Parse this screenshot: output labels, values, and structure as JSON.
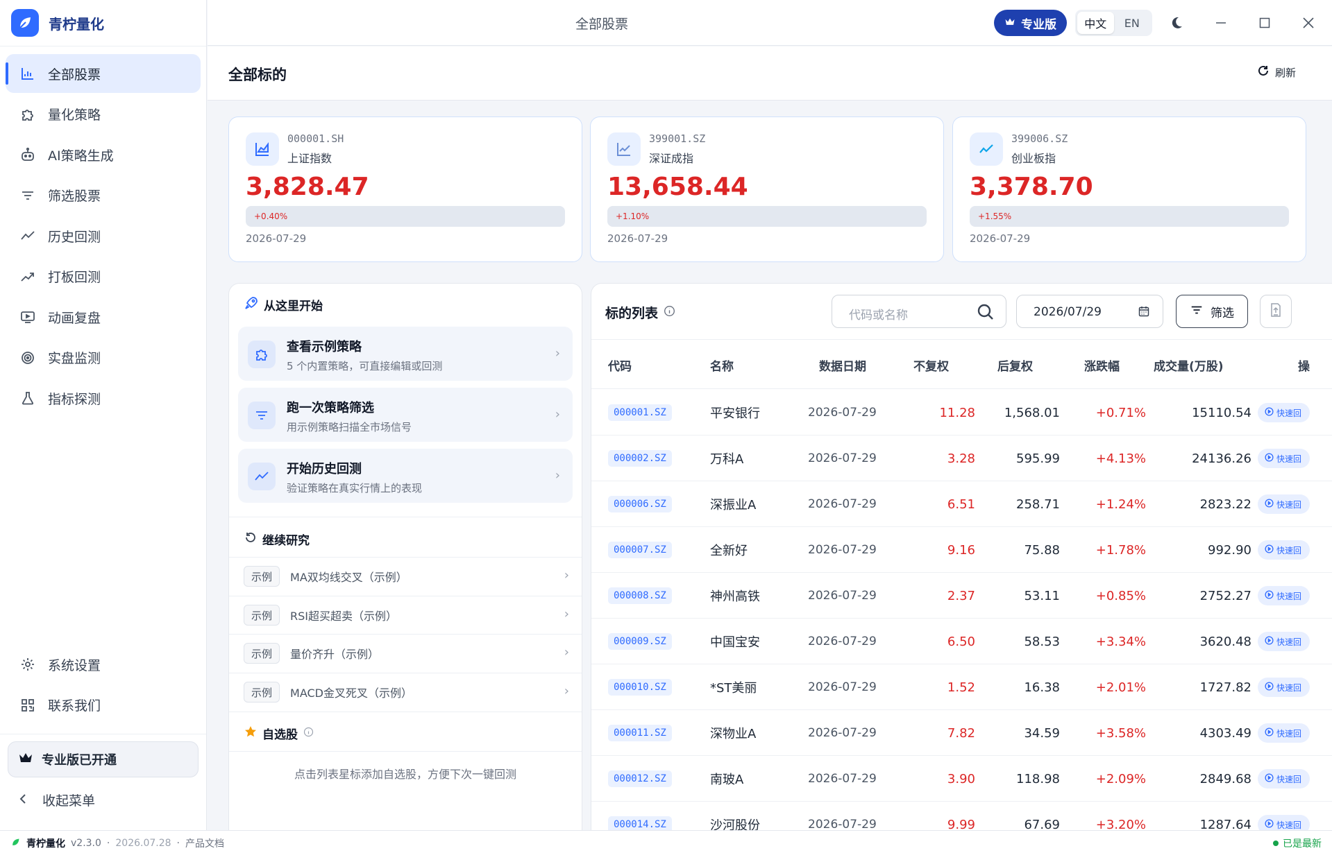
{
  "brand": {
    "name": "青柠量化"
  },
  "window": {
    "title": "全部股票",
    "pro_label": "专业版",
    "lang_zh": "中文",
    "lang_en": "EN"
  },
  "sidebar": {
    "items": [
      {
        "label": "全部股票",
        "icon": "bar-chart-icon"
      },
      {
        "label": "量化策略",
        "icon": "puzzle-icon"
      },
      {
        "label": "AI策略生成",
        "icon": "robot-icon"
      },
      {
        "label": "筛选股票",
        "icon": "filter-icon"
      },
      {
        "label": "历史回测",
        "icon": "trend-line-icon"
      },
      {
        "label": "打板回测",
        "icon": "trend-up-icon"
      },
      {
        "label": "动画复盘",
        "icon": "monitor-play-icon"
      },
      {
        "label": "实盘监测",
        "icon": "target-icon"
      },
      {
        "label": "指标探测",
        "icon": "flask-icon"
      }
    ],
    "bottom_items": [
      {
        "label": "系统设置",
        "icon": "gear-icon"
      },
      {
        "label": "联系我们",
        "icon": "qr-code-icon"
      }
    ],
    "pro_status": "专业版已开通",
    "collapse_label": "收起菜单"
  },
  "page": {
    "title": "全部标的",
    "refresh_label": "刷新"
  },
  "indices": [
    {
      "code": "000001.SH",
      "name": "上证指数",
      "value": "3,828.47",
      "change": "+0.40%",
      "date": "2026-07-29"
    },
    {
      "code": "399001.SZ",
      "name": "深证成指",
      "value": "13,658.44",
      "change": "+1.10%",
      "date": "2026-07-29"
    },
    {
      "code": "399006.SZ",
      "name": "创业板指",
      "value": "3,378.70",
      "change": "+1.55%",
      "date": "2026-07-29"
    }
  ],
  "start": {
    "title": "从这里开始",
    "cards": [
      {
        "title": "查看示例策略",
        "sub": "5 个内置策略，可直接编辑或回测"
      },
      {
        "title": "跑一次策略筛选",
        "sub": "用示例策略扫描全市场信号"
      },
      {
        "title": "开始历史回测",
        "sub": "验证策略在真实行情上的表现"
      }
    ],
    "continue_title": "继续研究",
    "examples": [
      {
        "tag": "示例",
        "name": "MA双均线交叉（示例）"
      },
      {
        "tag": "示例",
        "name": "RSI超买超卖（示例）"
      },
      {
        "tag": "示例",
        "name": "量价齐升（示例）"
      },
      {
        "tag": "示例",
        "name": "MACD金叉死叉（示例）"
      }
    ],
    "watch_title": "自选股",
    "watch_hint": "点击列表星标添加自选股，方便下次一键回测"
  },
  "table": {
    "title": "标的列表",
    "search_placeholder": "代码或名称",
    "date": "2026/07/29",
    "filter_label": "筛选",
    "columns": [
      "代码",
      "名称",
      "数据日期",
      "不复权",
      "后复权",
      "涨跌幅",
      "成交量(万股)",
      "操"
    ],
    "quick_label": "快速回",
    "rows": [
      {
        "code": "000001.SZ",
        "name": "平安银行",
        "date": "2026-07-29",
        "raw": "11.28",
        "adj": "1,568.01",
        "chg": "+0.71%",
        "vol": "15110.54"
      },
      {
        "code": "000002.SZ",
        "name": "万科A",
        "date": "2026-07-29",
        "raw": "3.28",
        "adj": "595.99",
        "chg": "+4.13%",
        "vol": "24136.26"
      },
      {
        "code": "000006.SZ",
        "name": "深振业A",
        "date": "2026-07-29",
        "raw": "6.51",
        "adj": "258.71",
        "chg": "+1.24%",
        "vol": "2823.22"
      },
      {
        "code": "000007.SZ",
        "name": "全新好",
        "date": "2026-07-29",
        "raw": "9.16",
        "adj": "75.88",
        "chg": "+1.78%",
        "vol": "992.90"
      },
      {
        "code": "000008.SZ",
        "name": "神州高铁",
        "date": "2026-07-29",
        "raw": "2.37",
        "adj": "53.11",
        "chg": "+0.85%",
        "vol": "2752.27"
      },
      {
        "code": "000009.SZ",
        "name": "中国宝安",
        "date": "2026-07-29",
        "raw": "6.50",
        "adj": "58.53",
        "chg": "+3.34%",
        "vol": "3620.48"
      },
      {
        "code": "000010.SZ",
        "name": "*ST美丽",
        "date": "2026-07-29",
        "raw": "1.52",
        "adj": "16.38",
        "chg": "+2.01%",
        "vol": "1727.82"
      },
      {
        "code": "000011.SZ",
        "name": "深物业A",
        "date": "2026-07-29",
        "raw": "7.82",
        "adj": "34.59",
        "chg": "+3.58%",
        "vol": "4303.49"
      },
      {
        "code": "000012.SZ",
        "name": "南玻A",
        "date": "2026-07-29",
        "raw": "3.90",
        "adj": "118.98",
        "chg": "+2.09%",
        "vol": "2849.68"
      },
      {
        "code": "000014.SZ",
        "name": "沙河股份",
        "date": "2026-07-29",
        "raw": "9.99",
        "adj": "67.69",
        "chg": "+3.20%",
        "vol": "1287.64"
      }
    ]
  },
  "statusbar": {
    "app": "青柠量化",
    "version": "v2.3.0",
    "build_date": "2026.07.28",
    "docs": "产品文档",
    "update_status": "已是最新"
  },
  "colors": {
    "accent": "#2f6bff",
    "up": "#dc2626",
    "brand_dark": "#1e40af",
    "ok": "#16a34a"
  }
}
